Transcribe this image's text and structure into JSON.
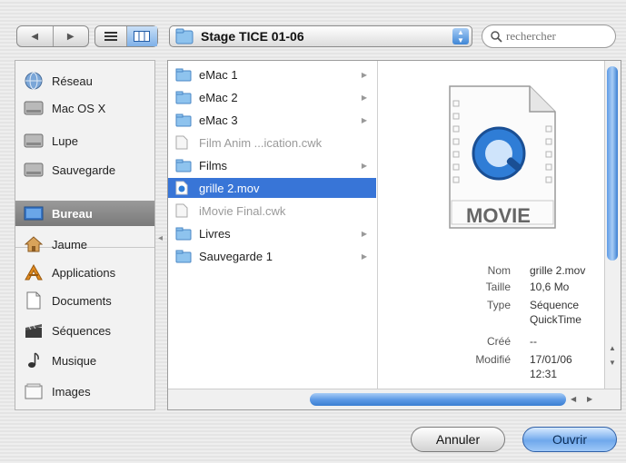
{
  "toolbar": {
    "location": "Stage TICE 01-06",
    "search_placeholder": "rechercher"
  },
  "sidebar": {
    "items": [
      {
        "label": "Réseau"
      },
      {
        "label": "Mac OS X"
      },
      {
        "label": "Lupe"
      },
      {
        "label": "Sauvegarde"
      },
      {
        "label": "Bureau"
      },
      {
        "label": "Jaume"
      },
      {
        "label": "Applications"
      },
      {
        "label": "Documents"
      },
      {
        "label": "Séquences"
      },
      {
        "label": "Musique"
      },
      {
        "label": "Images"
      }
    ],
    "selected": "Bureau"
  },
  "files": [
    {
      "name": "eMac 1",
      "kind": "folder"
    },
    {
      "name": "eMac 2",
      "kind": "folder"
    },
    {
      "name": "eMac 3",
      "kind": "folder"
    },
    {
      "name": "Film Anim ...ication.cwk",
      "kind": "document",
      "disabled": true
    },
    {
      "name": "Films",
      "kind": "folder"
    },
    {
      "name": "grille 2.mov",
      "kind": "movie",
      "selected": true
    },
    {
      "name": "iMovie Final.cwk",
      "kind": "document",
      "disabled": true
    },
    {
      "name": "Livres",
      "kind": "folder"
    },
    {
      "name": "Sauvegarde 1",
      "kind": "folder"
    }
  ],
  "preview": {
    "icon_caption": "MOVIE",
    "info": [
      {
        "k": "Nom",
        "v": "grille 2.mov"
      },
      {
        "k": "Taille",
        "v": "10,6 Mo"
      },
      {
        "k": "Type",
        "v": "Séquence",
        "v2": "QuickTime"
      },
      {
        "k": "Créé",
        "v": "--"
      },
      {
        "k": "Modifié",
        "v": "17/01/06",
        "v2": "12:31"
      }
    ]
  },
  "buttons": {
    "cancel": "Annuler",
    "open": "Ouvrir"
  },
  "colors": {
    "selection": "#3875d7",
    "default_button": "#6fa8ec",
    "sidebar_selection": "#7a7a7a"
  }
}
